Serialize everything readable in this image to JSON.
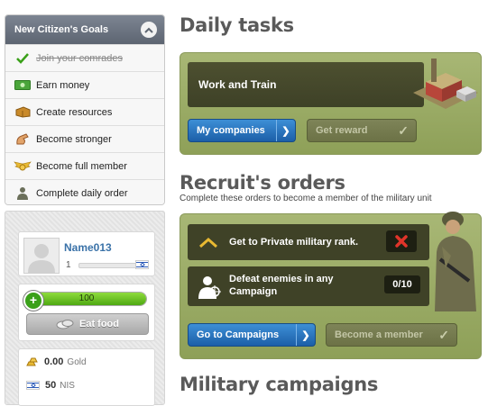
{
  "goals": {
    "title": "New Citizen's Goals",
    "items": [
      {
        "label": "Join your comrades",
        "icon": "checkmark-icon",
        "done": true
      },
      {
        "label": "Earn money",
        "icon": "money-bill-icon"
      },
      {
        "label": "Create resources",
        "icon": "crate-icon"
      },
      {
        "label": "Become stronger",
        "icon": "strength-icon"
      },
      {
        "label": "Become full member",
        "icon": "wings-badge-icon"
      },
      {
        "label": "Complete daily order",
        "icon": "soldier-icon"
      }
    ]
  },
  "profile": {
    "username": "Name013",
    "level": "1",
    "country_flag": "israel-flag-icon"
  },
  "health": {
    "value": "100",
    "fraction": 1.0,
    "eat_label": "Eat food"
  },
  "wallet": {
    "gold_amount": "0.00",
    "gold_label": "Gold",
    "nis_amount": "50",
    "nis_label": "NIS"
  },
  "daily_tasks": {
    "title": "Daily tasks",
    "task_label": "Work and Train",
    "companies_button": "My companies",
    "reward_button": "Get reward"
  },
  "recruit": {
    "title": "Recruit's orders",
    "subtitle": "Complete these orders to become a member of the military unit",
    "orders": [
      {
        "label": "Get to Private military rank.",
        "status": "not-completed"
      },
      {
        "label": "Defeat enemies in any Campaign",
        "progress": "0/10"
      }
    ],
    "campaigns_button": "Go to Campaigns",
    "member_button": "Become a member"
  },
  "campaigns": {
    "title": "Military campaigns"
  },
  "colors": {
    "accent_blue": "#1c5fa8",
    "panel_green": "#99aa62",
    "health_green": "#4ea812",
    "username_blue": "#3a72a8"
  }
}
